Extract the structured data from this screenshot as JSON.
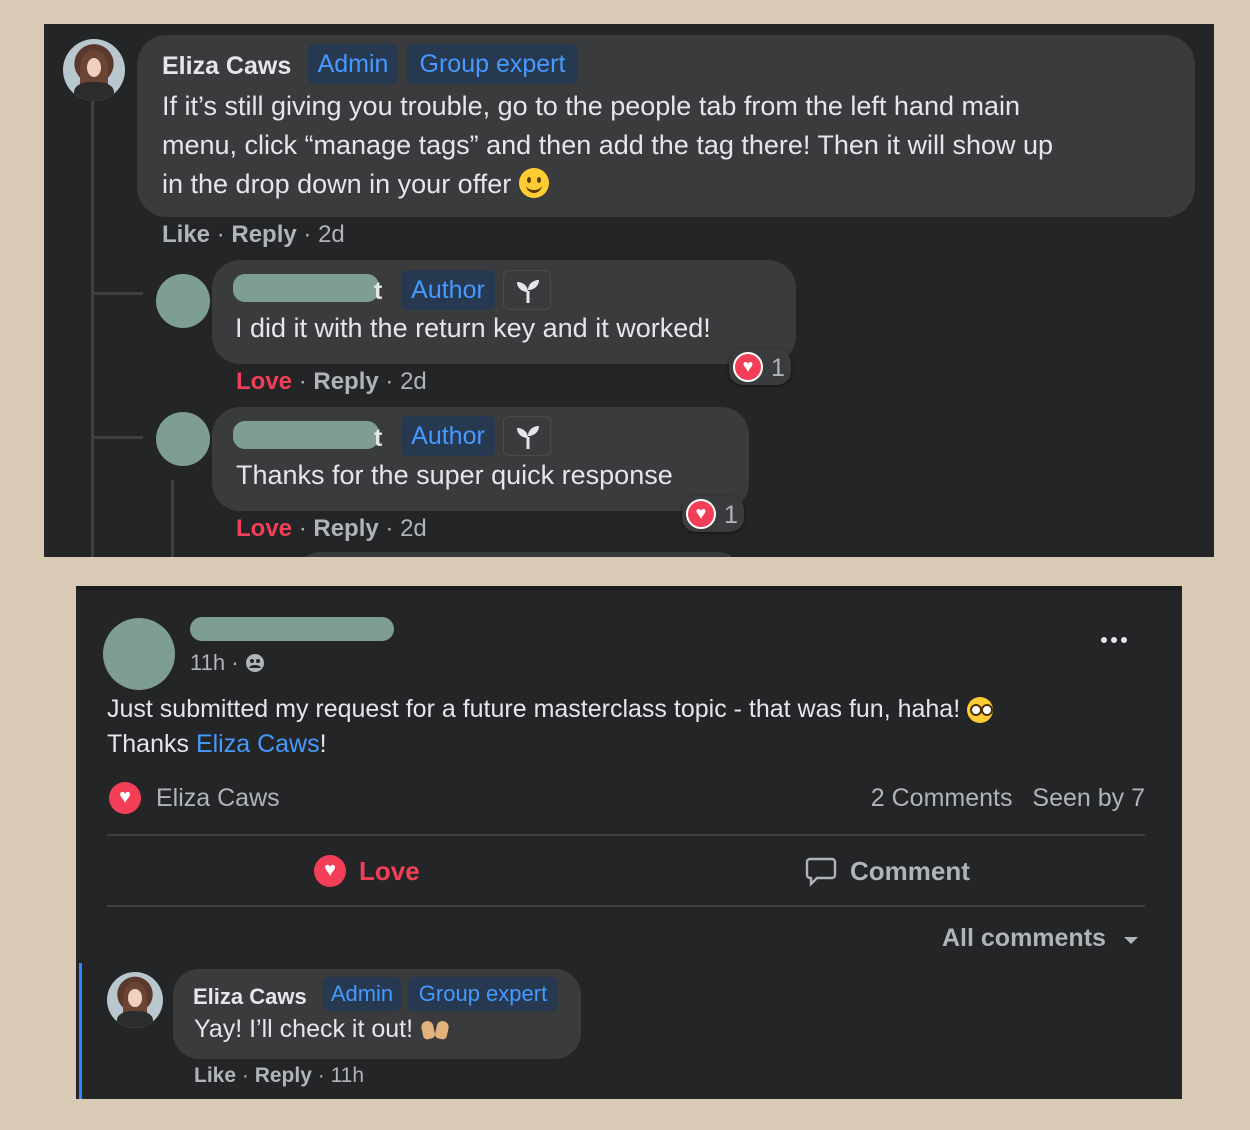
{
  "panel1": {
    "top_comment": {
      "author": "Eliza Caws",
      "badges": [
        "Admin",
        "Group expert"
      ],
      "text_line1": "If it’s still giving you trouble, go to the people tab from the left hand main",
      "text_line2": "menu, click “manage tags” and then add the tag there! Then it will show up",
      "text_line3": "in the drop down in your offer",
      "like": "Like",
      "reply": "Reply",
      "time": "2d"
    },
    "reply1": {
      "name_suffix": "t",
      "badge": "Author",
      "badge_icon": "sprout-icon",
      "text": "I did it with the return key and it worked!",
      "reaction_label": "Love",
      "reply": "Reply",
      "time": "2d",
      "reaction_count": "1"
    },
    "reply2": {
      "name_suffix": "t",
      "badge": "Author",
      "badge_icon": "sprout-icon",
      "text": "Thanks for the super quick response",
      "reaction_label": "Love",
      "reply": "Reply",
      "time": "2d",
      "reaction_count": "1"
    }
  },
  "panel2": {
    "post": {
      "time": "11h",
      "audience_icon": "group-icon",
      "more_icon": "more-dots-icon",
      "text_line1": "Just submitted my request for a future masterclass topic - that was fun, haha!",
      "text_line2_prefix": "Thanks ",
      "text_line2_link": "Eliza Caws",
      "text_line2_suffix": "!",
      "reactor": "Eliza Caws",
      "comments_count": "2 Comments",
      "seen_by": "Seen by 7"
    },
    "actions": {
      "love": "Love",
      "comment": "Comment"
    },
    "sort": {
      "label": "All comments"
    },
    "comment": {
      "author": "Eliza Caws",
      "badges": [
        "Admin",
        "Group expert"
      ],
      "text": "Yay! I’ll check it out!",
      "like": "Like",
      "reply": "Reply",
      "time": "11h"
    }
  },
  "colors": {
    "background": "#d9cab5",
    "panel": "#242526",
    "bubble": "#3a3b3c",
    "accent_blue": "#4599ff",
    "love_red": "#f33e58",
    "redaction": "#7f9e92"
  }
}
